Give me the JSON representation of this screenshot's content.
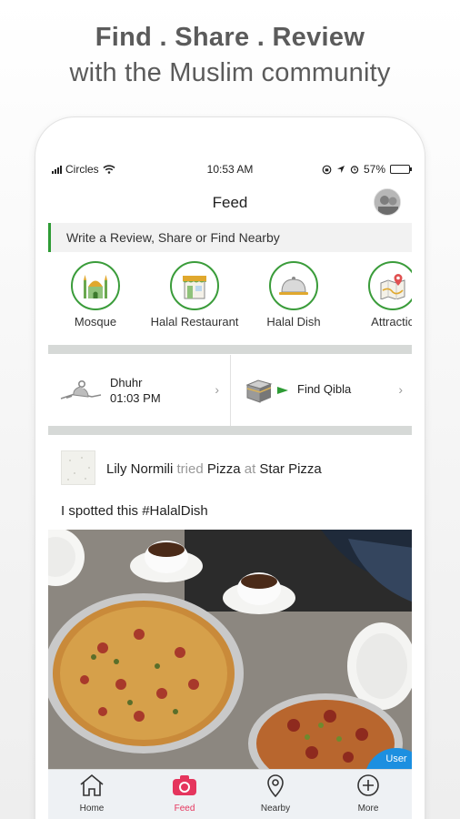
{
  "promo": {
    "line1": "Find . Share . Review",
    "line2": "with the Muslim community"
  },
  "status_bar": {
    "carrier": "Circles",
    "time": "10:53 AM",
    "battery": "57%",
    "battery_level": 0.57
  },
  "header": {
    "title": "Feed"
  },
  "prompt": {
    "text": "Write a Review, Share or Find Nearby"
  },
  "categories": [
    {
      "label": "Mosque",
      "icon": "mosque-icon"
    },
    {
      "label": "Halal Restaurant",
      "icon": "restaurant-icon"
    },
    {
      "label": "Halal Dish",
      "icon": "cloche-icon"
    },
    {
      "label": "Attractio",
      "icon": "map-pin-icon"
    }
  ],
  "prayer": {
    "name": "Dhuhr",
    "time": "01:03 PM"
  },
  "qibla": {
    "label": "Find Qibla"
  },
  "post": {
    "user": "Lily Normili",
    "verb": "tried",
    "dish": "Pizza",
    "at": "at",
    "place": "Star Pizza",
    "caption": "I spotted this #HalalDish",
    "badge": "User"
  },
  "tabs": [
    {
      "label": "Home",
      "icon": "home-icon"
    },
    {
      "label": "Feed",
      "icon": "camera-icon"
    },
    {
      "label": "Nearby",
      "icon": "location-pin-icon"
    },
    {
      "label": "More",
      "icon": "plus-circle-icon"
    }
  ],
  "colors": {
    "accent_green": "#3a9c3a",
    "active_tab": "#e5355d",
    "badge_blue": "#1c8fe0"
  }
}
